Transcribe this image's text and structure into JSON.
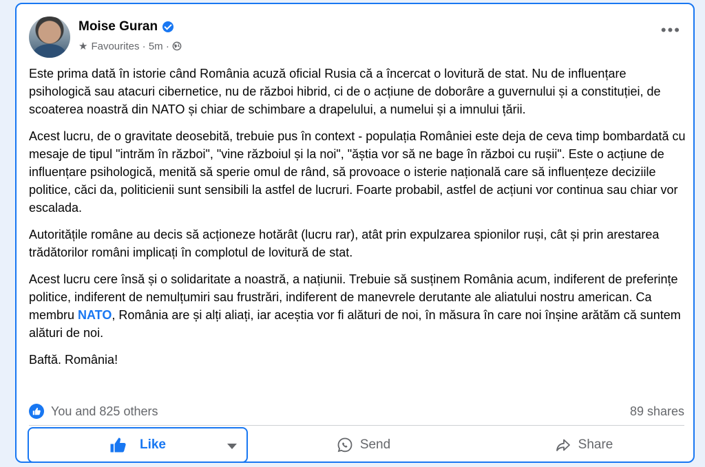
{
  "post": {
    "author": "Moise Guran",
    "audience": "Favourites",
    "time": "5m",
    "paragraphs": [
      "Este prima dată în istorie când România acuză oficial Rusia că a încercat o lovitură de stat. Nu de influențare psihologică sau atacuri cibernetice, nu de război hibrid, ci de o acțiune de doborâre a guvernului și a constituției, de scoaterea noastră din NATO și chiar de schimbare a drapelului, a numelui și a imnului țării.",
      "Acest lucru, de o gravitate deosebită, trebuie pus în context - populația României este deja de ceva timp bombardată cu mesaje de tipul \"intrăm în război\", \"vine războiul și la noi\", \"ăștia vor să ne bage în război cu rușii\". Este o acțiune de influențare psihologică, menită să sperie omul de rând, să provoace o isterie națională care să influențeze deciziile politice, căci da, politicienii sunt sensibili la astfel de lucruri. Foarte probabil, astfel de acțiuni vor continua sau chiar vor escalada.",
      "Autoritățile române au decis să acționeze hotărât (lucru rar), atât prin expulzarea spionilor ruși, cât și prin arestarea trădătorilor români implicați în complotul de lovitură de stat."
    ],
    "para4_before": "Acest lucru cere însă și o solidaritate a noastră, a națiunii. Trebuie să  susținem România acum, indiferent de preferințe politice, indiferent de nemulțumiri sau frustrări, indiferent de manevrele derutante ale aliatului nostru american. Ca membru ",
    "para4_link": "NATO",
    "para4_after": ", România are și alți aliați, iar aceștia vor fi alături de noi, în măsura în care noi înșine arătăm că suntem alături de noi.",
    "closing": "Baftă. România!"
  },
  "reactions": {
    "summary": "You and 825 others",
    "shares": "89 shares"
  },
  "actions": {
    "like": "Like",
    "send": "Send",
    "share": "Share"
  },
  "colors": {
    "accent": "#1877f2",
    "muted": "#65676b"
  }
}
